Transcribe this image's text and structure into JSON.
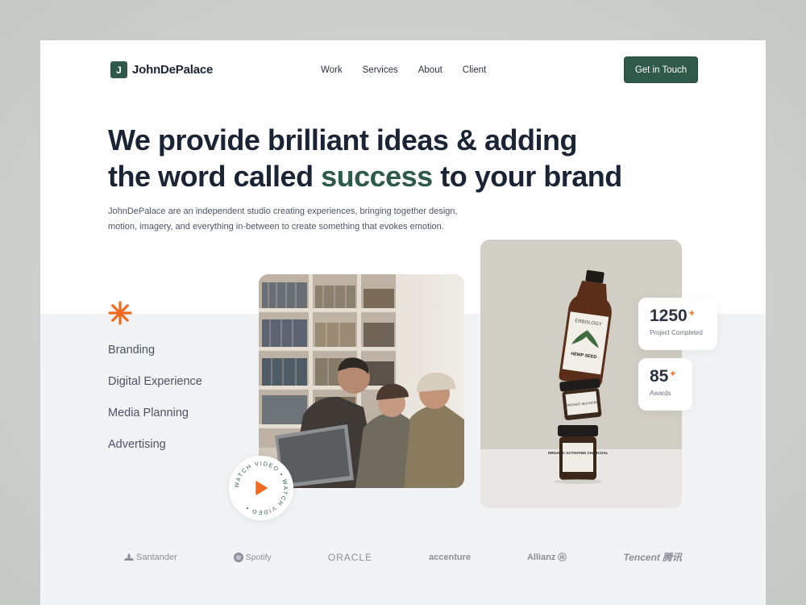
{
  "brand": {
    "mark": "J",
    "name": "JohnDePalace"
  },
  "nav": {
    "items": [
      "Work",
      "Services",
      "About",
      "Client"
    ],
    "cta": "Get in Touch"
  },
  "hero": {
    "headline_part1": "We provide brilliant ideas & adding",
    "headline_part2": "the word called",
    "headline_accent": "success",
    "headline_part3": "to your brand",
    "description_line1": "JohnDePalace are an independent studio creating experiences, bringing together design,",
    "description_line2": "motion, imagery, and everything in-between to create something that evokes emotion."
  },
  "services": [
    "Branding",
    "Digital Experience",
    "Media Planning",
    "Advertising"
  ],
  "watch_video": {
    "label": "WATCH VIDEO • WATCH VIDEO •"
  },
  "products": {
    "bottle_brand": "ERBOLOGY",
    "bottle_label": "HEMP SEED",
    "jar_small_label": "ORGANIC SEA MOSS",
    "jar_large_label": "ORGANIC ACTIVATED CHARCOAL"
  },
  "stats": [
    {
      "value": "1250",
      "suffix": "+",
      "label": "Project Completed"
    },
    {
      "value": "85",
      "suffix": "+",
      "label": "Awards"
    }
  ],
  "clients": [
    "Santander",
    "Spotify",
    "ORACLE",
    "accenture",
    "Allianz",
    "Tencent",
    "腾讯"
  ],
  "colors": {
    "accent_green": "#2f5a49",
    "accent_orange": "#f06a1f",
    "heading": "#1b2435",
    "band": "#f1f3f5"
  }
}
